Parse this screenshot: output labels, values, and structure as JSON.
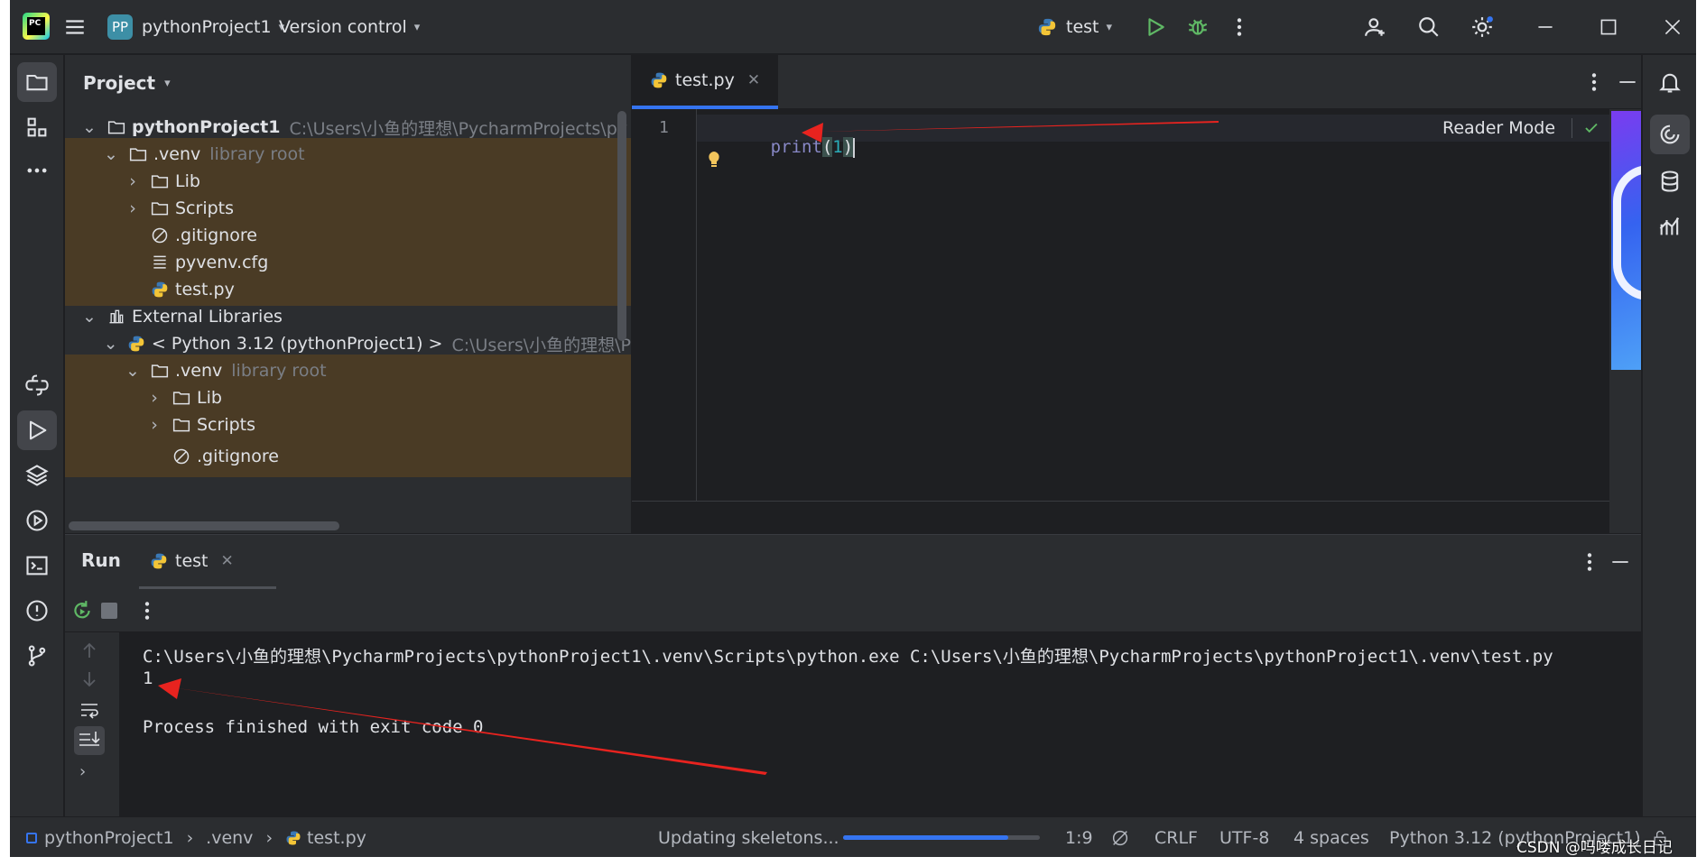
{
  "titlebar": {
    "logo_text": "PC",
    "project_badge": "PP",
    "project_name": "pythonProject1",
    "vcs_label": "Version control",
    "run_config": "test"
  },
  "project_panel": {
    "title": "Project",
    "rows": [
      {
        "label": "pythonProject1",
        "note": "C:\\Users\\小鱼的理想\\PycharmProjects\\py"
      },
      {
        "label": ".venv",
        "note": "library root"
      },
      {
        "label": "Lib",
        "note": ""
      },
      {
        "label": "Scripts",
        "note": ""
      },
      {
        "label": ".gitignore",
        "note": ""
      },
      {
        "label": "pyvenv.cfg",
        "note": ""
      },
      {
        "label": "test.py",
        "note": ""
      },
      {
        "label": "External Libraries",
        "note": ""
      },
      {
        "label": "< Python 3.12 (pythonProject1) >",
        "note": "C:\\Users\\小鱼的理想\\P"
      },
      {
        "label": ".venv",
        "note": "library root"
      },
      {
        "label": "Lib",
        "note": ""
      },
      {
        "label": "Scripts",
        "note": ""
      },
      {
        "label": ".gitignore",
        "note": ""
      }
    ]
  },
  "editor": {
    "tab_label": "test.py",
    "line_number": "1",
    "code_fn": "print",
    "code_open": "(",
    "code_arg": "1",
    "code_close": ")",
    "reader_mode": "Reader Mode"
  },
  "run_panel": {
    "title": "Run",
    "tab_label": "test",
    "console": [
      "C:\\Users\\小鱼的理想\\PycharmProjects\\pythonProject1\\.venv\\Scripts\\python.exe C:\\Users\\小鱼的理想\\PycharmProjects\\pythonProject1\\.venv\\test.py",
      "1",
      "",
      "Process finished with exit code 0"
    ]
  },
  "statusbar": {
    "crumb_project": "pythonProject1",
    "crumb_venv": ".venv",
    "crumb_file": "test.py",
    "progress_text": "Updating skeletons...",
    "progress_fraction": 0.84,
    "position": "1:9",
    "line_sep": "CRLF",
    "encoding": "UTF-8",
    "indent": "4 spaces",
    "interpreter": "Python 3.12 (pythonProject1)"
  },
  "watermark": "CSDN @吗喽成长日记",
  "colors": {
    "accent": "#3574f0",
    "annotation_arrow": "#e8231f",
    "venv_highlight": "#4a3b25",
    "run_green": "#5fb865"
  }
}
